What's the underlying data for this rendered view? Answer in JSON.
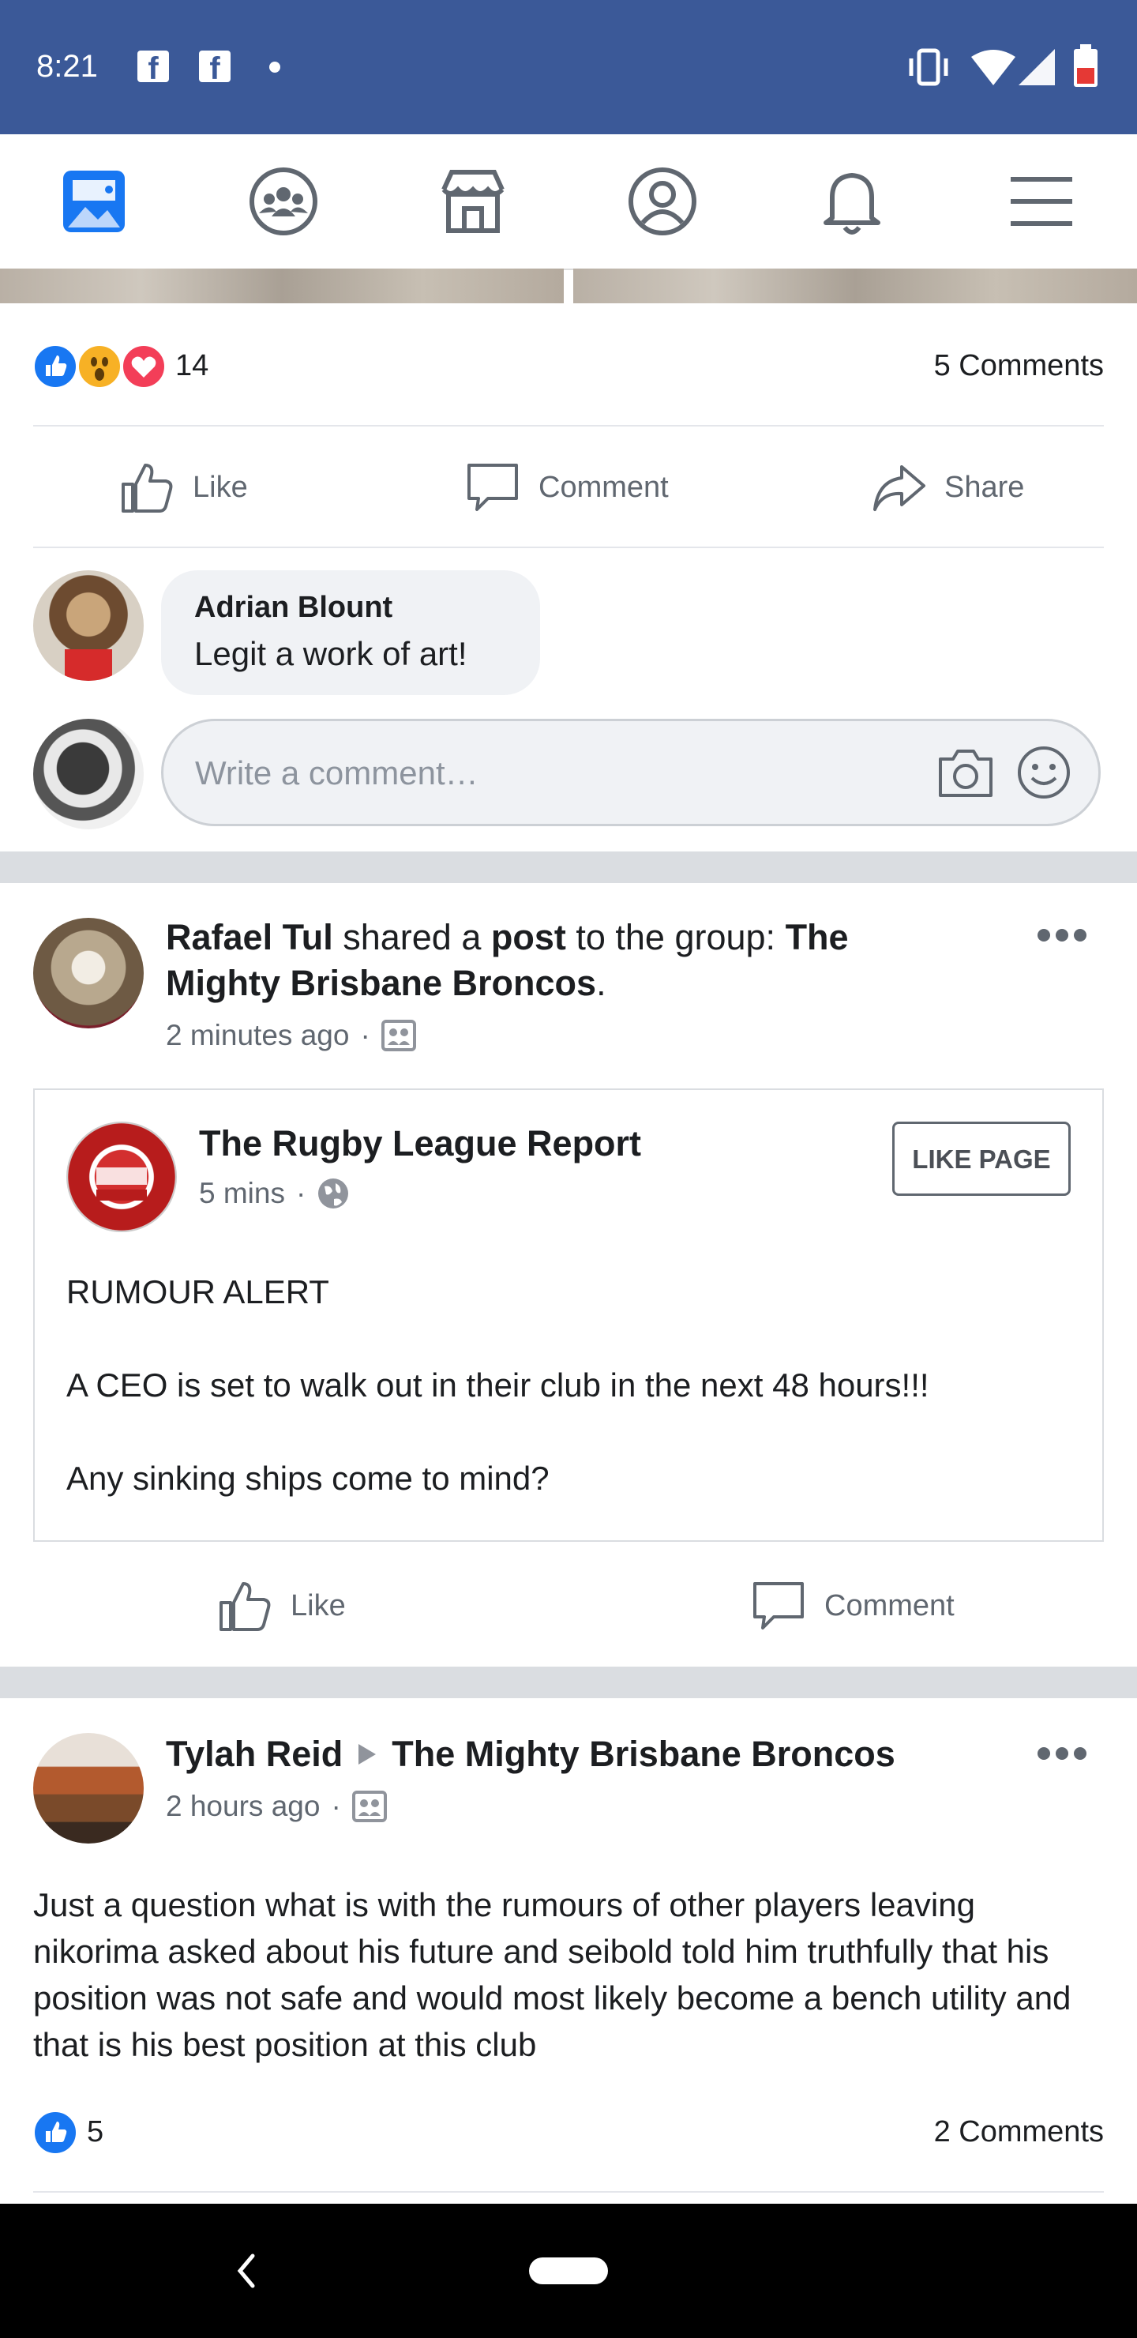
{
  "status": {
    "time": "8:21"
  },
  "nav": {
    "items": [
      "news-feed",
      "groups",
      "marketplace",
      "profile",
      "notifications",
      "menu"
    ]
  },
  "post1": {
    "reaction_count": "14",
    "comments_count": "5 Comments",
    "actions": {
      "like": "Like",
      "comment": "Comment",
      "share": "Share"
    },
    "comment": {
      "author": "Adrian Blount",
      "text": "Legit a work of art!"
    },
    "write_placeholder": "Write a comment…"
  },
  "post2": {
    "author": "Rafael Tul",
    "shared_text_1": " shared a ",
    "shared_text_post": "post",
    "shared_text_2": " to the group: ",
    "group_line1": "The",
    "group_line2": "Mighty Brisbane Broncos",
    "group_suffix": ".",
    "time": "2 minutes ago",
    "shared": {
      "page_name": "The Rugby League Report",
      "time": "5 mins",
      "like_page": "LIKE PAGE",
      "line1": "RUMOUR ALERT",
      "line2": "A CEO is set to walk out in their club in the next 48 hours!!!",
      "line3": "Any sinking ships come to mind?"
    },
    "actions": {
      "like": "Like",
      "comment": "Comment"
    }
  },
  "post3": {
    "author": "Tylah Reid",
    "group": "The Mighty Brisbane Broncos",
    "time": "2 hours ago",
    "body": "Just a question what is with the rumours of other players leaving nikorima asked about his future and seibold told him truthfully that his position was not safe and would most likely become a bench utility and that is his best position at this club",
    "reaction_count": "5",
    "comments_count": "2 Comments"
  },
  "colors": {
    "brand": "#3b5998",
    "like_blue": "#1877f2",
    "love_red": "#f33e58",
    "wow_yellow": "#f7b125"
  }
}
